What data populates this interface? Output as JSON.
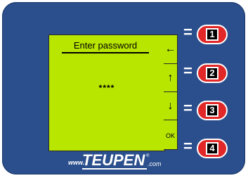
{
  "lcd": {
    "title": "Enter password",
    "password_mask": "****"
  },
  "softkeys": [
    {
      "label": "←",
      "icon": "arrow-left-icon"
    },
    {
      "label": "↑",
      "icon": "arrow-up-icon"
    },
    {
      "label": "↓",
      "icon": "arrow-down-icon"
    },
    {
      "label": "OK",
      "icon": "ok-icon"
    }
  ],
  "hardware_buttons": [
    {
      "eq": "=",
      "number": "1"
    },
    {
      "eq": "=",
      "number": "2"
    },
    {
      "eq": "=",
      "number": "3"
    },
    {
      "eq": "=",
      "number": "4"
    }
  ],
  "brand": {
    "prefix": "www.",
    "name": "TEUPEN",
    "reg": "®",
    "suffix": ".com"
  },
  "colors": {
    "panel": "#2b4f8c",
    "lcd": "#b8e600",
    "button": "#e12727"
  }
}
